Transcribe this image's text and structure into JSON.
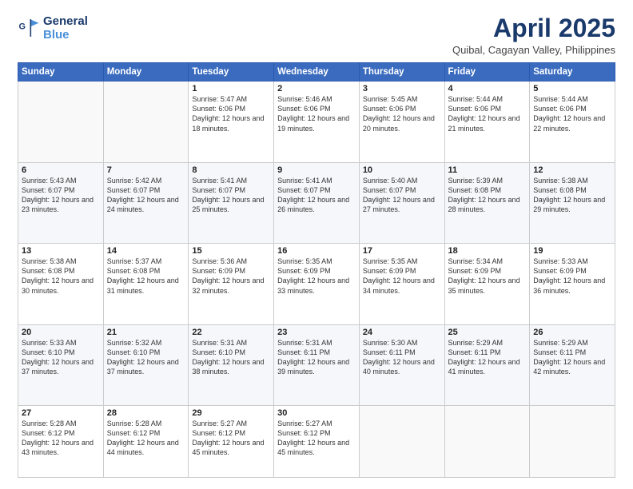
{
  "logo": {
    "line1": "General",
    "line2": "Blue"
  },
  "title": "April 2025",
  "subtitle": "Quibal, Cagayan Valley, Philippines",
  "days_header": [
    "Sunday",
    "Monday",
    "Tuesday",
    "Wednesday",
    "Thursday",
    "Friday",
    "Saturday"
  ],
  "weeks": [
    [
      {
        "num": "",
        "info": ""
      },
      {
        "num": "",
        "info": ""
      },
      {
        "num": "1",
        "info": "Sunrise: 5:47 AM\nSunset: 6:06 PM\nDaylight: 12 hours and 18 minutes."
      },
      {
        "num": "2",
        "info": "Sunrise: 5:46 AM\nSunset: 6:06 PM\nDaylight: 12 hours and 19 minutes."
      },
      {
        "num": "3",
        "info": "Sunrise: 5:45 AM\nSunset: 6:06 PM\nDaylight: 12 hours and 20 minutes."
      },
      {
        "num": "4",
        "info": "Sunrise: 5:44 AM\nSunset: 6:06 PM\nDaylight: 12 hours and 21 minutes."
      },
      {
        "num": "5",
        "info": "Sunrise: 5:44 AM\nSunset: 6:06 PM\nDaylight: 12 hours and 22 minutes."
      }
    ],
    [
      {
        "num": "6",
        "info": "Sunrise: 5:43 AM\nSunset: 6:07 PM\nDaylight: 12 hours and 23 minutes."
      },
      {
        "num": "7",
        "info": "Sunrise: 5:42 AM\nSunset: 6:07 PM\nDaylight: 12 hours and 24 minutes."
      },
      {
        "num": "8",
        "info": "Sunrise: 5:41 AM\nSunset: 6:07 PM\nDaylight: 12 hours and 25 minutes."
      },
      {
        "num": "9",
        "info": "Sunrise: 5:41 AM\nSunset: 6:07 PM\nDaylight: 12 hours and 26 minutes."
      },
      {
        "num": "10",
        "info": "Sunrise: 5:40 AM\nSunset: 6:07 PM\nDaylight: 12 hours and 27 minutes."
      },
      {
        "num": "11",
        "info": "Sunrise: 5:39 AM\nSunset: 6:08 PM\nDaylight: 12 hours and 28 minutes."
      },
      {
        "num": "12",
        "info": "Sunrise: 5:38 AM\nSunset: 6:08 PM\nDaylight: 12 hours and 29 minutes."
      }
    ],
    [
      {
        "num": "13",
        "info": "Sunrise: 5:38 AM\nSunset: 6:08 PM\nDaylight: 12 hours and 30 minutes."
      },
      {
        "num": "14",
        "info": "Sunrise: 5:37 AM\nSunset: 6:08 PM\nDaylight: 12 hours and 31 minutes."
      },
      {
        "num": "15",
        "info": "Sunrise: 5:36 AM\nSunset: 6:09 PM\nDaylight: 12 hours and 32 minutes."
      },
      {
        "num": "16",
        "info": "Sunrise: 5:35 AM\nSunset: 6:09 PM\nDaylight: 12 hours and 33 minutes."
      },
      {
        "num": "17",
        "info": "Sunrise: 5:35 AM\nSunset: 6:09 PM\nDaylight: 12 hours and 34 minutes."
      },
      {
        "num": "18",
        "info": "Sunrise: 5:34 AM\nSunset: 6:09 PM\nDaylight: 12 hours and 35 minutes."
      },
      {
        "num": "19",
        "info": "Sunrise: 5:33 AM\nSunset: 6:09 PM\nDaylight: 12 hours and 36 minutes."
      }
    ],
    [
      {
        "num": "20",
        "info": "Sunrise: 5:33 AM\nSunset: 6:10 PM\nDaylight: 12 hours and 37 minutes."
      },
      {
        "num": "21",
        "info": "Sunrise: 5:32 AM\nSunset: 6:10 PM\nDaylight: 12 hours and 37 minutes."
      },
      {
        "num": "22",
        "info": "Sunrise: 5:31 AM\nSunset: 6:10 PM\nDaylight: 12 hours and 38 minutes."
      },
      {
        "num": "23",
        "info": "Sunrise: 5:31 AM\nSunset: 6:11 PM\nDaylight: 12 hours and 39 minutes."
      },
      {
        "num": "24",
        "info": "Sunrise: 5:30 AM\nSunset: 6:11 PM\nDaylight: 12 hours and 40 minutes."
      },
      {
        "num": "25",
        "info": "Sunrise: 5:29 AM\nSunset: 6:11 PM\nDaylight: 12 hours and 41 minutes."
      },
      {
        "num": "26",
        "info": "Sunrise: 5:29 AM\nSunset: 6:11 PM\nDaylight: 12 hours and 42 minutes."
      }
    ],
    [
      {
        "num": "27",
        "info": "Sunrise: 5:28 AM\nSunset: 6:12 PM\nDaylight: 12 hours and 43 minutes."
      },
      {
        "num": "28",
        "info": "Sunrise: 5:28 AM\nSunset: 6:12 PM\nDaylight: 12 hours and 44 minutes."
      },
      {
        "num": "29",
        "info": "Sunrise: 5:27 AM\nSunset: 6:12 PM\nDaylight: 12 hours and 45 minutes."
      },
      {
        "num": "30",
        "info": "Sunrise: 5:27 AM\nSunset: 6:12 PM\nDaylight: 12 hours and 45 minutes."
      },
      {
        "num": "",
        "info": ""
      },
      {
        "num": "",
        "info": ""
      },
      {
        "num": "",
        "info": ""
      }
    ]
  ]
}
